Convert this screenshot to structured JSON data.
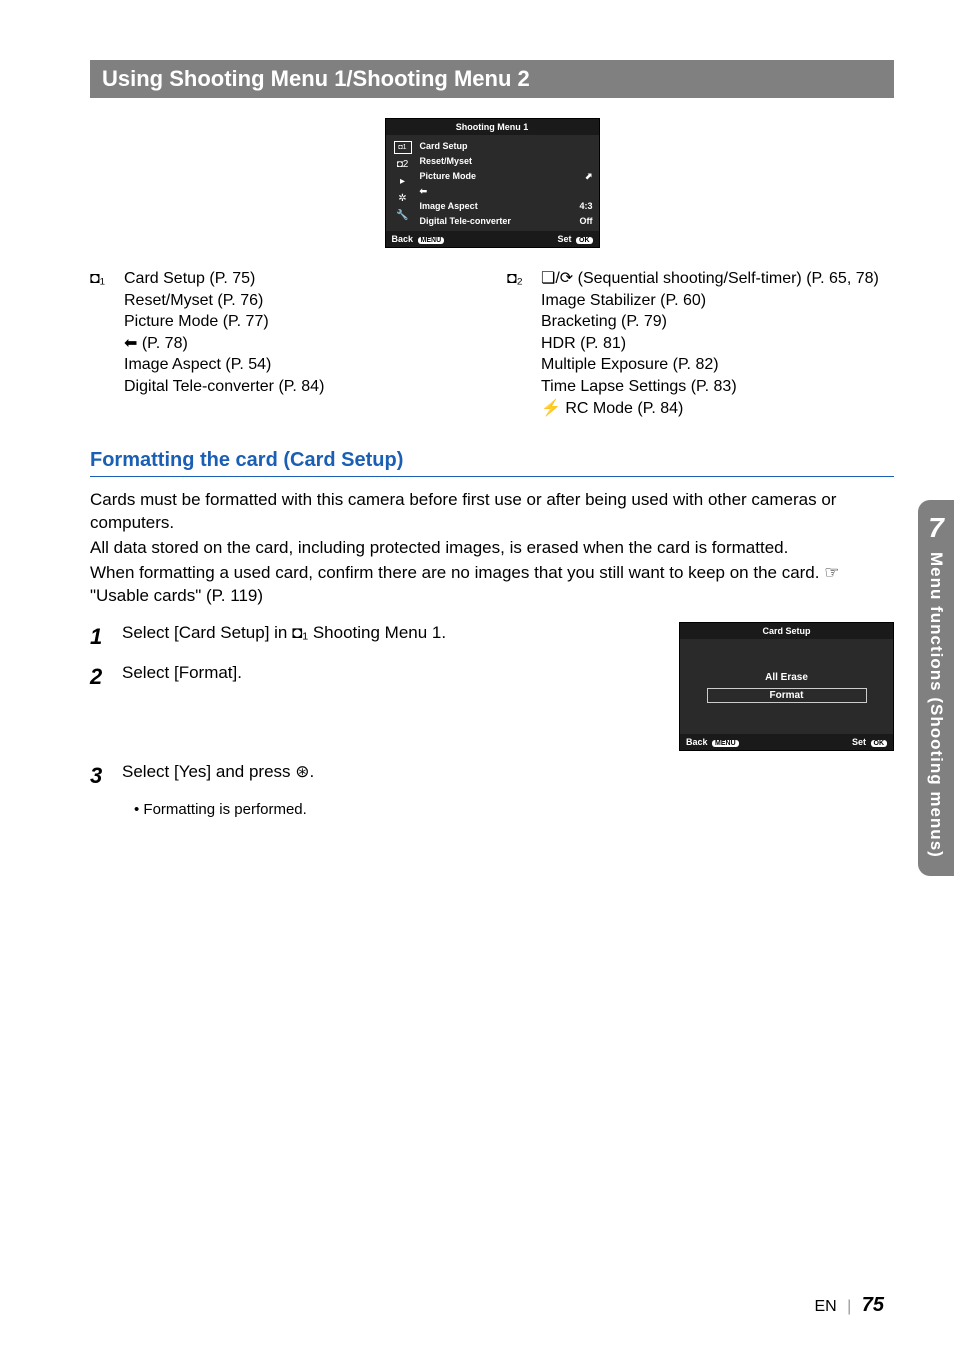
{
  "heading": "Using Shooting Menu 1/Shooting Menu 2",
  "menu_screenshot": {
    "title": "Shooting Menu 1",
    "items": [
      {
        "label": "Card Setup",
        "value": ""
      },
      {
        "label": "Reset/Myset",
        "value": ""
      },
      {
        "label": "Picture Mode",
        "value": "⬈"
      },
      {
        "label": "⬅",
        "value": ""
      },
      {
        "label": "Image Aspect",
        "value": "4:3"
      },
      {
        "label": "Digital Tele-converter",
        "value": "Off"
      }
    ],
    "footer_left": "Back",
    "footer_left_badge": "MENU",
    "footer_right": "Set",
    "footer_right_badge": "OK"
  },
  "left_col": {
    "icon": "◘₁",
    "lines": [
      "Card Setup (P. 75)",
      "Reset/Myset (P. 76)",
      "Picture Mode (P. 77)",
      "⬅ (P. 78)",
      "Image Aspect (P. 54)",
      "Digital Tele-converter (P. 84)"
    ]
  },
  "right_col": {
    "icon": "◘₂",
    "lines": [
      "❏/⟳ (Sequential shooting/Self-timer) (P. 65, 78)",
      "Image Stabilizer (P. 60)",
      "Bracketing (P. 79)",
      "HDR (P. 81)",
      "Multiple Exposure (P. 82)",
      "Time Lapse Settings (P. 83)",
      "⚡ RC Mode (P. 84)"
    ]
  },
  "section_heading": "Formatting the card (Card Setup)",
  "body_paragraphs": [
    "Cards must be formatted with this camera before first use or after being used with other cameras or computers.",
    "All data stored on the card, including protected images, is erased when the card is formatted.",
    "When formatting a used card, confirm there are no images that you still want to keep on the card. ☞ \"Usable cards\" (P. 119)"
  ],
  "steps": {
    "s1": {
      "num": "1",
      "text": "Select [Card Setup] in ◘₁ Shooting Menu 1."
    },
    "s2": {
      "num": "2",
      "text": "Select [Format]."
    },
    "s3": {
      "num": "3",
      "text": "Select [Yes] and press ⊛.",
      "sub": "• Formatting is performed."
    }
  },
  "card_setup_screenshot": {
    "title": "Card Setup",
    "option1": "All Erase",
    "option2": "Format",
    "footer_left": "Back",
    "footer_left_badge": "MENU",
    "footer_right": "Set",
    "footer_right_badge": "OK"
  },
  "side_tab": {
    "num": "7",
    "text": "Menu functions (Shooting menus)"
  },
  "footer": {
    "lang": "EN",
    "page": "75"
  }
}
